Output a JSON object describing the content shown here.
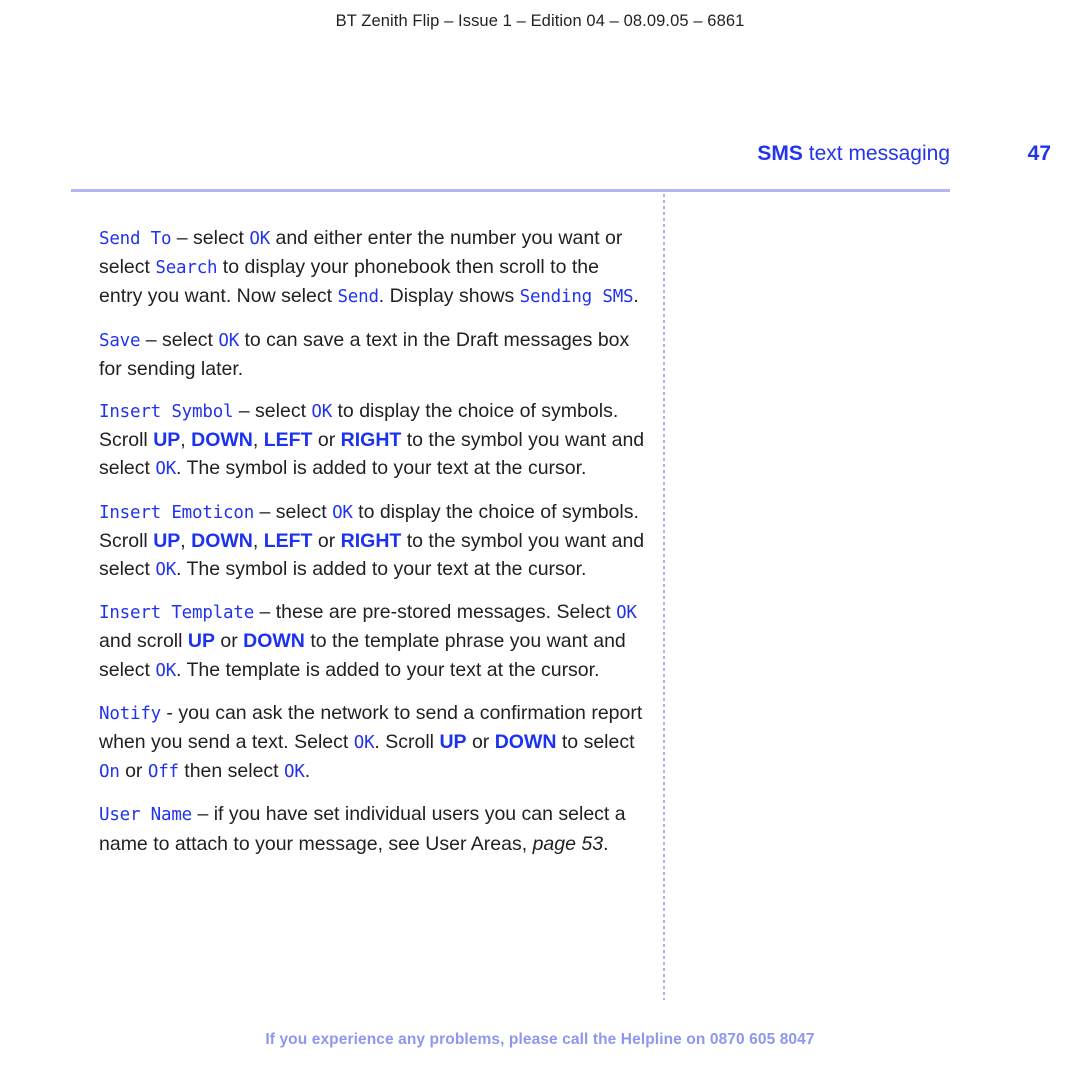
{
  "running_head": "BT Zenith Flip – Issue 1 – Edition 04 – 08.09.05 – 6861",
  "header": {
    "chapter_title_strong": "SMS",
    "chapter_title_rest": " text messaging",
    "page_number": "47"
  },
  "colors": {
    "accent_blue": "#2233ee",
    "key_blue": "#1b33f0",
    "rule_lavender": "#b3b8f5",
    "footer_lavender": "#8e97ef",
    "body_black": "#231f20"
  },
  "paragraphs": [
    {
      "id": "send-to",
      "runs": [
        {
          "t": "Send To",
          "s": "lcd"
        },
        {
          "t": " – select ",
          "s": "body"
        },
        {
          "t": "OK",
          "s": "lcd"
        },
        {
          "t": " and either enter the number you want or select ",
          "s": "body"
        },
        {
          "t": "Search",
          "s": "lcd"
        },
        {
          "t": " to display your phonebook then scroll to the entry you want. Now select ",
          "s": "body"
        },
        {
          "t": "Send",
          "s": "lcd"
        },
        {
          "t": ". Display shows ",
          "s": "body"
        },
        {
          "t": "Sending SMS",
          "s": "lcd"
        },
        {
          "t": ".",
          "s": "body"
        }
      ]
    },
    {
      "id": "save",
      "runs": [
        {
          "t": "Save",
          "s": "lcd"
        },
        {
          "t": " – select ",
          "s": "body"
        },
        {
          "t": "OK",
          "s": "lcd"
        },
        {
          "t": " to can save a text in the Draft messages box for sending later.",
          "s": "body"
        }
      ]
    },
    {
      "id": "insert-symbol",
      "runs": [
        {
          "t": "Insert Symbol",
          "s": "lcd"
        },
        {
          "t": " – select ",
          "s": "body"
        },
        {
          "t": "OK",
          "s": "lcd"
        },
        {
          "t": " to display the choice of symbols. Scroll ",
          "s": "body"
        },
        {
          "t": "UP",
          "s": "key"
        },
        {
          "t": ", ",
          "s": "body"
        },
        {
          "t": "DOWN",
          "s": "key"
        },
        {
          "t": ", ",
          "s": "body"
        },
        {
          "t": "LEFT",
          "s": "key"
        },
        {
          "t": " or ",
          "s": "body"
        },
        {
          "t": "RIGHT",
          "s": "key"
        },
        {
          "t": " to the symbol you want and select ",
          "s": "body"
        },
        {
          "t": "OK",
          "s": "lcd"
        },
        {
          "t": ". The symbol is added to your text at the cursor.",
          "s": "body"
        }
      ]
    },
    {
      "id": "insert-emoticon",
      "runs": [
        {
          "t": "Insert Emoticon",
          "s": "lcd"
        },
        {
          "t": " – select ",
          "s": "body"
        },
        {
          "t": "OK",
          "s": "lcd"
        },
        {
          "t": " to display the choice of symbols. Scroll ",
          "s": "body"
        },
        {
          "t": "UP",
          "s": "key"
        },
        {
          "t": ", ",
          "s": "body"
        },
        {
          "t": "DOWN",
          "s": "key"
        },
        {
          "t": ", ",
          "s": "body"
        },
        {
          "t": "LEFT",
          "s": "key"
        },
        {
          "t": " or ",
          "s": "body"
        },
        {
          "t": "RIGHT",
          "s": "key"
        },
        {
          "t": " to the symbol you want and select ",
          "s": "body"
        },
        {
          "t": "OK",
          "s": "lcd"
        },
        {
          "t": ". The symbol is added to your text at the cursor.",
          "s": "body"
        }
      ]
    },
    {
      "id": "insert-template",
      "runs": [
        {
          "t": "Insert Template",
          "s": "lcd"
        },
        {
          "t": " – these are pre-stored messages. Select ",
          "s": "body"
        },
        {
          "t": "OK",
          "s": "lcd"
        },
        {
          "t": " and scroll ",
          "s": "body"
        },
        {
          "t": "UP",
          "s": "key"
        },
        {
          "t": " or ",
          "s": "body"
        },
        {
          "t": "DOWN",
          "s": "key"
        },
        {
          "t": " to the template phrase you want and select ",
          "s": "body"
        },
        {
          "t": "OK",
          "s": "lcd"
        },
        {
          "t": ". The template is added to your text at the cursor.",
          "s": "body"
        }
      ]
    },
    {
      "id": "notify",
      "runs": [
        {
          "t": "Notify",
          "s": "lcd"
        },
        {
          "t": " - you can ask the network to send a confirmation report when you send a text. Select ",
          "s": "body"
        },
        {
          "t": "OK",
          "s": "lcd"
        },
        {
          "t": ". Scroll ",
          "s": "body"
        },
        {
          "t": "UP",
          "s": "key"
        },
        {
          "t": " or ",
          "s": "body"
        },
        {
          "t": "DOWN",
          "s": "key"
        },
        {
          "t": " to select ",
          "s": "body"
        },
        {
          "t": "On",
          "s": "lcd"
        },
        {
          "t": " or ",
          "s": "body"
        },
        {
          "t": "Off",
          "s": "lcd"
        },
        {
          "t": " then select ",
          "s": "body"
        },
        {
          "t": "OK",
          "s": "lcd"
        },
        {
          "t": ".",
          "s": "body"
        }
      ]
    },
    {
      "id": "user-name",
      "runs": [
        {
          "t": "User Name",
          "s": "lcd"
        },
        {
          "t": " – if you have set individual users you can select a name to attach to your message, see User Areas, ",
          "s": "body"
        },
        {
          "t": "page 53",
          "s": "ital"
        },
        {
          "t": ".",
          "s": "body"
        }
      ]
    }
  ],
  "footer": {
    "text": "If you experience any problems, please call the Helpline on ",
    "phone": "0870 605 8047"
  }
}
